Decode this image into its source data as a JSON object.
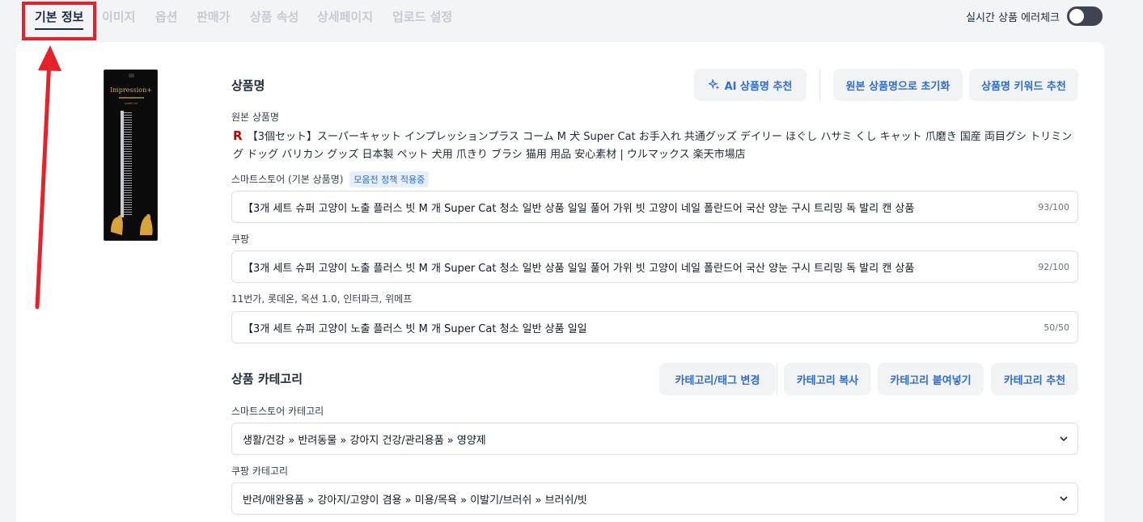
{
  "tabs": [
    {
      "label": "기본 정보",
      "active": true
    },
    {
      "label": "이미지"
    },
    {
      "label": "옵션"
    },
    {
      "label": "판매가"
    },
    {
      "label": "상품 속성"
    },
    {
      "label": "상세페이지"
    },
    {
      "label": "업로드 설정"
    }
  ],
  "realtime_check": {
    "label": "실시간 상품 에러체크",
    "enabled": false
  },
  "product_image": {
    "brand": "Impression+",
    "subtext": "SUPER CAT"
  },
  "product_name": {
    "title": "상품명",
    "buttons": {
      "ai": "AI 상품명 추천",
      "reset": "원본 상품명으로 초기화",
      "keyword": "상품명 키워드 추천"
    },
    "original_label": "원본 상품명",
    "original_icon": "R",
    "original_text": "【3個セット】スーパーキャット インプレッションプラス コーム M 犬 Super Cat お手入れ 共通グッズ デイリー ほぐし ハサミ くし キャット 爪磨き 国産 両目グシ トリミング ドッグ バリカン グッズ 日本製 ペット 犬用 爪きり ブラシ 猫用 用品 安心素材 | ウルマックス 楽天市場店",
    "smartstore_label": "스마트스토어 (기본 상품명)",
    "smartstore_badge": "모음전 정책 적용중",
    "smartstore_value": "【3개 세트  슈퍼 고양이 노출 플러스 빗 M 개 Super Cat 청소 일반 상품 일일 풀어 가위 빗 고양이 네일 폴란드어 국산 양눈 구시 트리밍 독 발리 캔 상품",
    "smartstore_count": "93/100",
    "coupang_label": "쿠팡",
    "coupang_value": "【3개 세트  슈퍼 고양이 노출 플러스 빗 M 개 Super Cat 청소 일반 상품 일일 풀어 가위 빗 고양이 네일 폴란드어 국산 양눈 구시 트리밍 독 발리 캔 상품",
    "coupang_count": "92/100",
    "other_label": "11번가, 롯데온, 옥션 1.0, 인터파크, 위메프",
    "other_value": "【3개 세트  슈퍼 고양이 노출 플러스 빗 M 개 Super Cat 청소 일반 상품 일일",
    "other_count": "50/50"
  },
  "category": {
    "title": "상품 카테고리",
    "buttons": {
      "change": "카테고리/태그 변경",
      "copy": "카테고리 복사",
      "paste": "카테고리 붙여넣기",
      "recommend": "카테고리 추천"
    },
    "smartstore_label": "스마트스토어 카테고리",
    "smartstore_value": "생활/건강 » 반려동물 » 강아지 건강/관리용품 » 영양제",
    "coupang_label": "쿠팡 카테고리",
    "coupang_value": "반려/애완용품 » 강아지/고양이 겸용 » 미용/목욕 » 이발기/브러쉬 » 브러쉬/빗"
  },
  "colors": {
    "accent": "#2f6bd8",
    "highlight": "#e8202a",
    "active_tab": "#1f2a44"
  }
}
